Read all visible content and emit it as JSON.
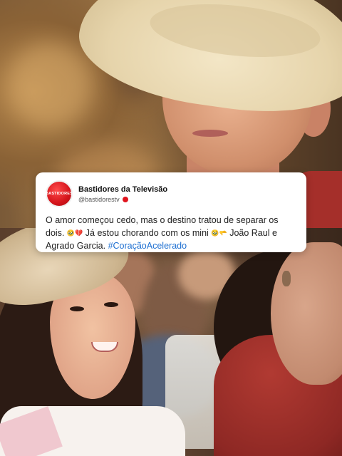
{
  "post": {
    "author_name": "Bastidores da Televisão",
    "author_handle": "@bastidorestv",
    "avatar_text": "BASTIDORES",
    "text_line_1": "O amor começou cedo, mas o destino tratou de separar os dois.",
    "emoji_1": "🥹💔",
    "text_line_2": "Já estou chorando com os mini",
    "emoji_2": "🥹🫳",
    "text_line_3": "João Raul e Agrado Garcia.",
    "hashtag": "#CoraçãoAcelerado"
  },
  "colors": {
    "brand_red": "#d4141b",
    "hashtag_blue": "#1d6fd1"
  }
}
